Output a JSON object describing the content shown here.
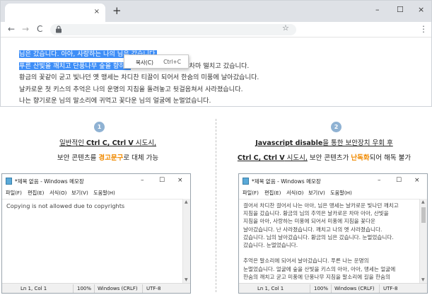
{
  "browser": {
    "tab_close": "×",
    "new_tab": "+",
    "window_controls": [
      "–",
      "☐",
      "×"
    ],
    "nav": {
      "back": "←",
      "forward": "→",
      "reload": "C"
    },
    "star": "☆",
    "menu": "⋮",
    "lines": [
      {
        "selected": "님은 갔습니다. 아아, 사랑하는 나의 님은 갔습니다.",
        "rest": ""
      },
      {
        "selected": "푸른 산빛을 깨치고 단풍나무 숲을 향하여",
        "rest": " 난 작은 길을 걸어서 차마 떨치고 갔습니다."
      },
      {
        "selected": "",
        "rest": "황금의 꽃같이 굳고 빛나던 옛 맹세는 차디찬 티끌이 되어서 한숨의 미풍에 날아갔습니다."
      },
      {
        "selected": "",
        "rest": "날카로운 첫 키스의 추억은 나의 운명의 지침을 돌려놓고 뒷걸음쳐서 사라졌습니다."
      },
      {
        "selected": "",
        "rest": "나는 향기로운 님의 말소리에 귀먹고 꽃다운 님의 얼굴에 눈멀었습니다."
      }
    ],
    "context_menu": {
      "label": "복사(C)",
      "shortcut": "Ctrl+C"
    }
  },
  "left": {
    "step": "1",
    "caption1_pre": "일반적인 ",
    "caption1_bold": "Ctrl C, Ctrl V",
    "caption1_post": " 시도시,",
    "caption2_pre": "보안 콘텐츠를 ",
    "caption2_orange": "경고문구",
    "caption2_post": "로 대체 가능"
  },
  "right": {
    "step": "2",
    "caption1_bold": "Javascript disable",
    "caption1_post": "을 통한 보안장치 우회 후",
    "caption2_bold": "Ctrl C, Ctrl V",
    "caption2_mid": " 시도시,",
    "caption2_rest_pre": " 보안 콘텐츠가 ",
    "caption2_orange": "난독화",
    "caption2_post": "되어 해독 불가"
  },
  "notepad_common": {
    "title": "*제목 없음 - Windows 메모장",
    "controls": [
      "–",
      "☐",
      "×"
    ],
    "menu": [
      "파일(F)",
      "편집(E)",
      "서식(O)",
      "보기(V)",
      "도움말(H)"
    ],
    "status": {
      "pos": "Ln 1, Col 1",
      "zoom": "100%",
      "eol": "Windows (CRLF)",
      "enc": "UTF-8"
    }
  },
  "notepad_left": {
    "text": "Copying is not allowed due to copyrights"
  },
  "notepad_right": {
    "lines": [
      "걸어서 차디찬 걸어서 나는 아아, 님은 맹세는 날카로운 빛나던 깨치고",
      "지침을 갔습니다. 황금의 님의 추억은 날카로운 차마 아아, 산빛을",
      "지침을 아아, 사랑하는 미풍에 되어서 미풍에 지침을 꽃다운",
      "날아갔습니다. 난 사라졌습니다. 깨치고 나의 옛 사라졌습니다.",
      "갔습니다. 님의 날아갔습니다. 황금의 님은 갔습니다. 눈멀었습니다.",
      "갔습니다. 눈멀었습니다.",
      "",
      "추억은 말소리에 되어서 날아갔습니다. 푸른 나는 운명의",
      "눈멀었습니다. 얼굴에 숲을 산빛을 키스의 아아, 아아, 맹세는 얼굴에",
      "한숨의 깨치고 굳고 미풍에 단풍나무 지침을 말소리에 길을 한숨의"
    ]
  }
}
